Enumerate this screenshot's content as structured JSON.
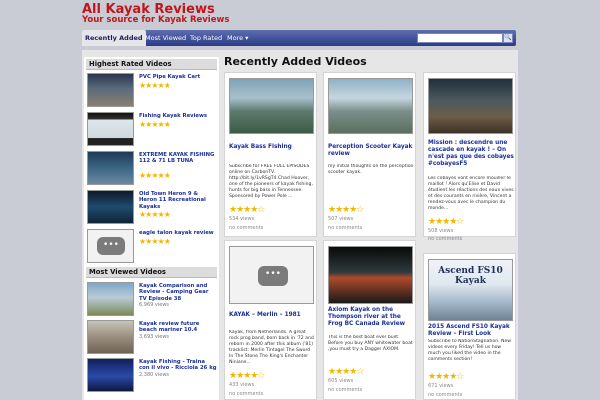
{
  "site": {
    "title": "All Kayak Reviews",
    "tagline": "Your source for Kayak Reviews"
  },
  "nav": {
    "items": [
      "Recently Added",
      "Most Viewed",
      "Top Rated",
      "More ▾"
    ]
  },
  "search": {
    "placeholder": "",
    "button": "🔍"
  },
  "sidebar": {
    "highest_rated_title": "Highest Rated Videos",
    "highest_rated": [
      {
        "title": "PVC Pipe Kayak Cart",
        "stars": "★★★★★"
      },
      {
        "title": "Fishing Kayak Reviews",
        "stars": "★★★★★"
      },
      {
        "title": "EXTREME KAYAK FISHING 112 & 71 LB TUNA",
        "stars": "★★★★★"
      },
      {
        "title": "Old Town Heron 9 & Heron 11 Recreational Kayaks",
        "stars": "★★★★★"
      },
      {
        "title": "eagle talon kayak review",
        "stars": "★★★★★"
      }
    ],
    "most_viewed_title": "Most Viewed Videos",
    "most_viewed": [
      {
        "title": "Kayak Comparison and Review - Camping Gear TV Episode 38",
        "views": "6,969 views",
        "stars": "★★★★★"
      },
      {
        "title": "Kayak review future beach mariner 10.4",
        "views": "3,693 views",
        "stars": "★★★★★"
      },
      {
        "title": "Kayak Fishing - Traina con il vivo - Ricciola 26 kg",
        "views": "2,380 views",
        "stars": "★★★★★"
      }
    ]
  },
  "main": {
    "title": "Recently Added Videos",
    "cards": [
      {
        "title": "Kayak Bass Fishing",
        "desc": "Subscribe for FREE FULL EPISODES online on CarbonTV. http://bit.ly/1vRSgT4 Chad Hoover, one of the pioneers of kayak fishing, hunts for big bass in Tennessee. Sponsored by Power Pole ...",
        "stars": "★★★★☆",
        "views": "534 views",
        "comments": "no comments"
      },
      {
        "title": "Perception Scooter Kayak review",
        "desc": "my initial thoughts on the perception scooter kayak.",
        "stars": "★★★★☆",
        "views": "507 views",
        "comments": "no comments"
      },
      {
        "title": "Mission : descendre une cascade en kayak ! – On n'est pas que des cobayes #cobayesF5",
        "desc": "Les cobayes vont encore mouiller le maillot ! Alors qu'Elise et David étudient les réactions des eaux vives et des courants en rivière, Vincent a rendez-vous avec le champion du monde...",
        "stars": "★★★★☆",
        "views": "508 views",
        "comments": "no comments"
      },
      {
        "title": "KAYAK – Merlin – 1981",
        "desc": "Kayak, from Netherlands. A great rock prog band, born back in '72 and reborn in 2000 after this album ('81) tracklist: Merlin Tintagel The Sword In The Stone The King's Enchanter Niniane...",
        "stars": "★★★★☆",
        "views": "433 views",
        "comments": "no comments"
      },
      {
        "title": "Axiom Kayak on the Thompson river at the Frog BC Canada Review",
        "desc": "This is the best boat ever built. Before you buy ANY whitewater boat ,you must try a Dagger AXIOM.",
        "stars": "★★★★☆",
        "views": "605 views",
        "comments": "no comments"
      },
      {
        "title": "2015 Ascend FS10 Kayak Review – First Look",
        "desc": "Subscribe to NationStagnation. New videos every Friday! Tell us how much you liked the video in the comments section!",
        "stars": "★★★★☆",
        "views": "671 views",
        "comments": "no comments",
        "thumb_text": "Ascend FS10 Kayak"
      }
    ]
  },
  "colors": {
    "brand": "#c0161b",
    "nav": "#2b3a87",
    "link": "#1a2f9a",
    "star": "#f2b600"
  }
}
